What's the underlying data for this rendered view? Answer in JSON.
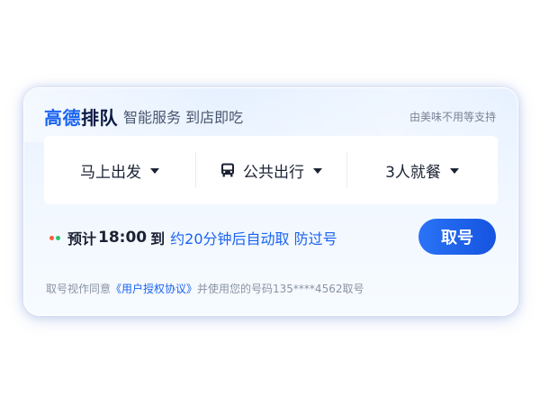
{
  "header": {
    "brand_a": "高德",
    "brand_b": "排队",
    "subtitle": "智能服务 到店即吃",
    "support": "由美味不用等支持"
  },
  "options": [
    {
      "label": "马上出发",
      "icon": "none"
    },
    {
      "label": "公共出行",
      "icon": "bus-icon"
    },
    {
      "label": "3人就餐",
      "icon": "none"
    }
  ],
  "eta": {
    "prefix": "预计",
    "time": "18:00",
    "to": "到",
    "note": "约20分钟后自动取 防过号",
    "dot_colors": [
      "#ff5a3c",
      "#28c76f"
    ]
  },
  "take_button": {
    "label": "取号"
  },
  "footer": {
    "pre": "取号视作同意",
    "link": "《用户授权协议》",
    "post": "并使用您的号码135****4562取号"
  },
  "colors": {
    "accent": "#1a63f0",
    "button": "#1e62ee",
    "card_bg": "#eaf3ff"
  }
}
